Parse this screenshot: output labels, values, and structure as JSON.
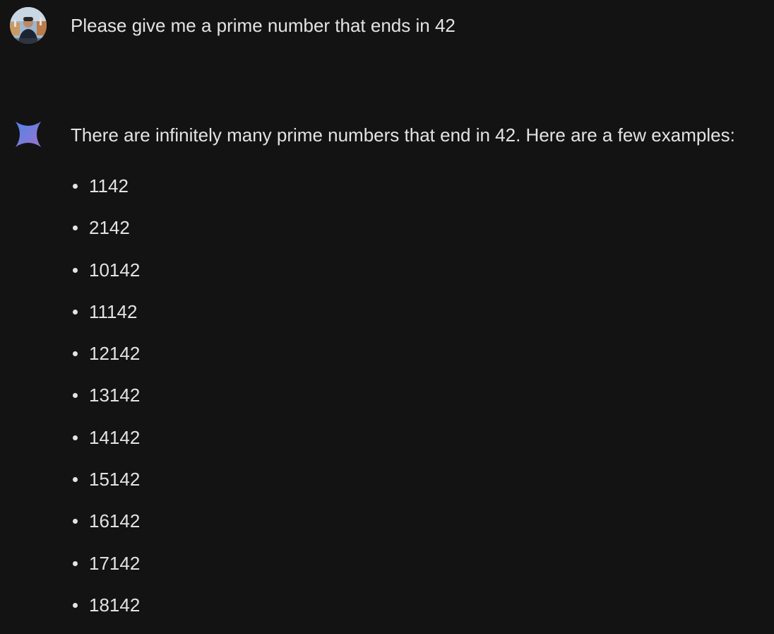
{
  "user_turn": {
    "avatar": "user-avatar-photo",
    "prompt": "Please give me a prime number that ends in 42"
  },
  "model_turn": {
    "icon": "gemini-sparkle-icon",
    "intro": "There are infinitely many prime numbers that end in 42. Here are a few examples:",
    "items": [
      {
        "value": "1142"
      },
      {
        "value": "2142"
      },
      {
        "value": "10142"
      },
      {
        "value": "11142"
      },
      {
        "value": "12142"
      },
      {
        "value": "13142"
      },
      {
        "value": "14142"
      },
      {
        "value": "15142"
      },
      {
        "value": "16142"
      },
      {
        "value": "17142"
      },
      {
        "value": "18142"
      }
    ]
  },
  "colors": {
    "background": "#131313",
    "text": "#e3e3e3",
    "gemini_gradient_start": "#4f86ec",
    "gemini_gradient_end": "#9b72cb"
  }
}
